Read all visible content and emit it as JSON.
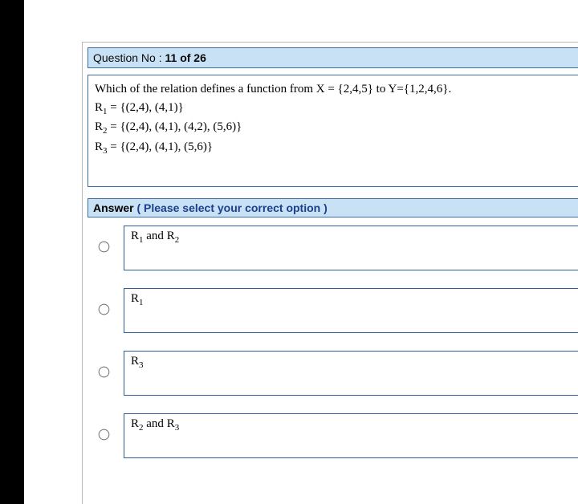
{
  "header": {
    "prefix": "Question No : ",
    "num": "11 of 26"
  },
  "question": {
    "prompt": "Which of the relation defines a function from X = {2,4,5} to Y={1,2,4,6}.",
    "r1_label": "R",
    "r1_sub": "1",
    "r1_def": " = {(2,4), (4,1)}",
    "r2_label": "R",
    "r2_sub": "2",
    "r2_def": " = {(2,4), (4,1), (4,2), (5,6)}",
    "r3_label": "R",
    "r3_sub": "3",
    "r3_def": " = {(2,4), (4,1), (5,6)}"
  },
  "answer_header": {
    "lead": "Answer ",
    "hint": "( Please select your correct option )"
  },
  "options": {
    "a": {
      "p1": "R",
      "s1": "1",
      "mid": " and ",
      "p2": "R",
      "s2": "2"
    },
    "b": {
      "p1": "R",
      "s1": "1"
    },
    "c": {
      "p1": "R",
      "s1": "3"
    },
    "d": {
      "p1": "R",
      "s1": "2",
      "mid": " and ",
      "p2": "R",
      "s2": "3"
    }
  }
}
